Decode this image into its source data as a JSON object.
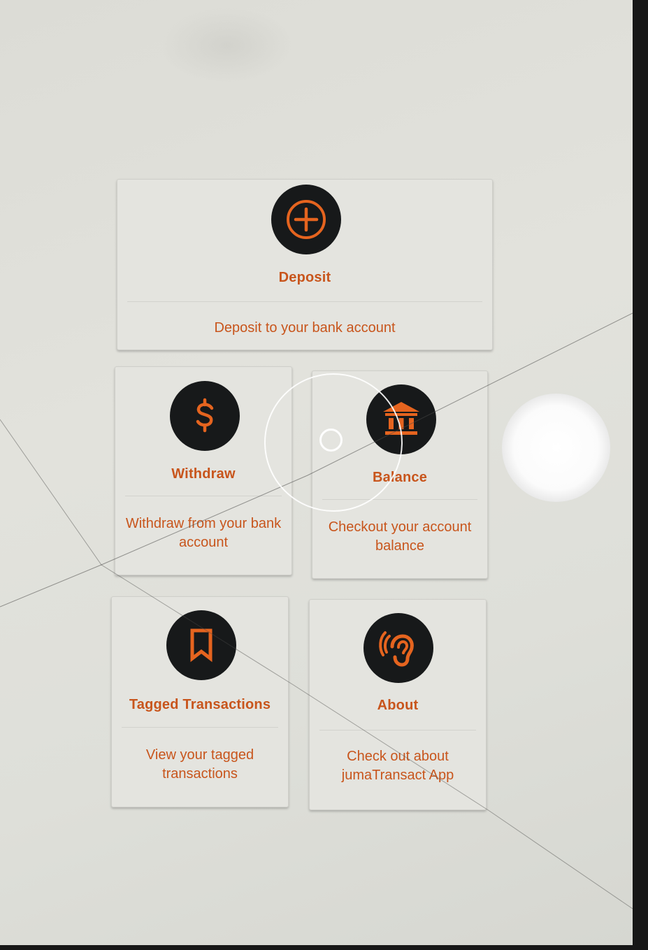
{
  "menu": {
    "deposit": {
      "title": "Deposit",
      "description": "Deposit to your bank account",
      "icon": "plus-circle-icon"
    },
    "withdraw": {
      "title": "Withdraw",
      "description": "Withdraw from your bank account",
      "icon": "dollar-icon"
    },
    "balance": {
      "title": "Balance",
      "description": "Checkout your account balance",
      "icon": "bank-icon"
    },
    "tagged": {
      "title": "Tagged Transactions",
      "description": "View your tagged transactions",
      "icon": "bookmark-icon"
    },
    "about": {
      "title": "About",
      "description": "Check out about jumaTransact App",
      "icon": "ear-icon"
    }
  },
  "colors": {
    "accent": "#c8551c",
    "icon_bg": "#17191a",
    "icon_fg": "#e5641f",
    "card_bg": "#e4e4df"
  }
}
